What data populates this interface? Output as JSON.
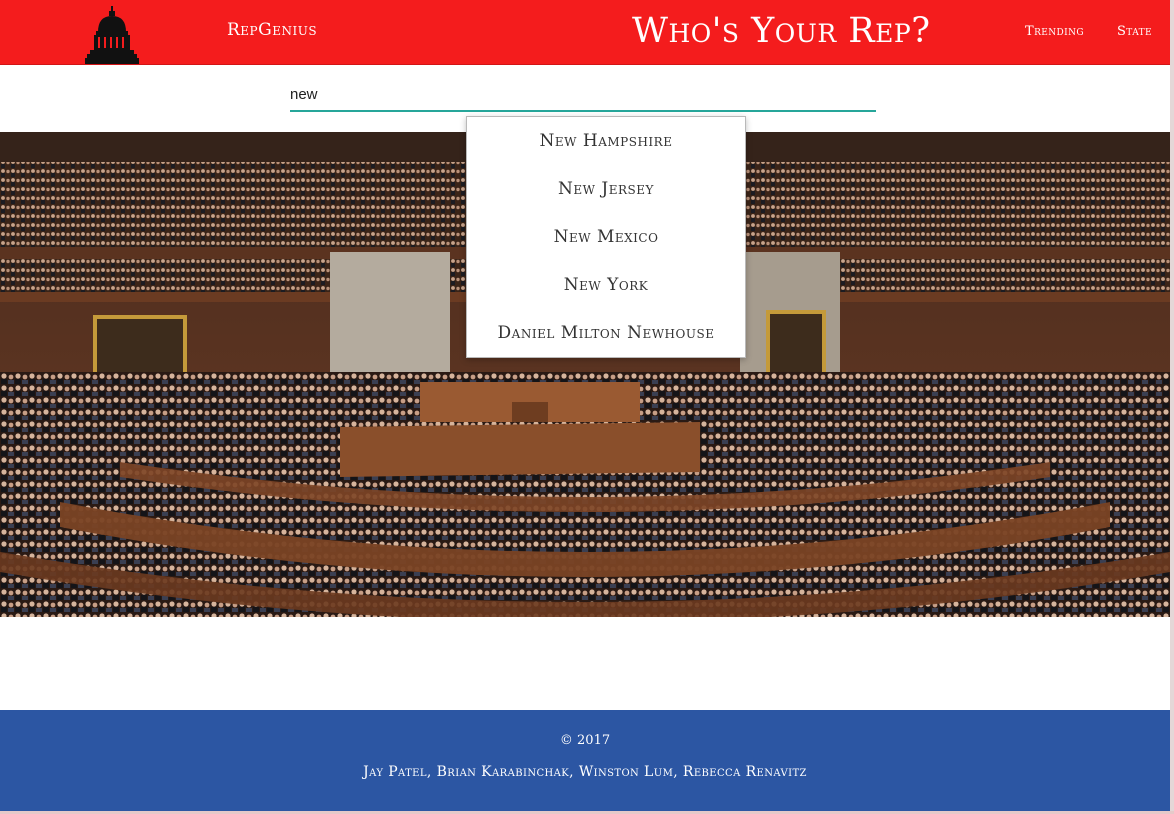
{
  "header": {
    "brand": "RepGenius",
    "headline": "Who's Your Rep?",
    "nav": [
      {
        "label": "Trending"
      },
      {
        "label": "State"
      }
    ],
    "logo_icon": "capitol-building-icon",
    "background_color": "#f41c1d"
  },
  "search": {
    "value": "new",
    "underline_color": "#26a69a"
  },
  "autocomplete": {
    "items": [
      {
        "label": "New Hampshire"
      },
      {
        "label": "New Jersey"
      },
      {
        "label": "New Mexico"
      },
      {
        "label": "New York"
      },
      {
        "label": "Daniel Milton Newhouse"
      }
    ]
  },
  "hero": {
    "image": "house-chamber-photo"
  },
  "footer": {
    "copyright": "© 2017",
    "credits": "Jay Patel, Brian Karabinchak, Winston Lum, Rebecca Renavitz",
    "background_color": "#2c56a3"
  }
}
